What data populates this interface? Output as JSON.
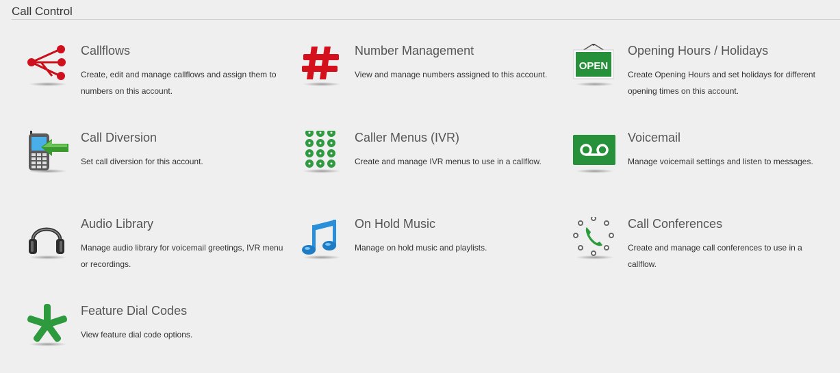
{
  "section": {
    "title": "Call Control"
  },
  "tiles": [
    {
      "title": "Callflows",
      "description": "Create, edit and manage callflows and assign them to numbers on this account.",
      "icon": "callflows-icon"
    },
    {
      "title": "Number Management",
      "description": "View and manage numbers assigned to this account.",
      "icon": "hash-icon"
    },
    {
      "title": "Opening Hours / Holidays",
      "description": "Create Opening Hours and set holidays for different opening times on this account.",
      "icon": "open-sign-icon",
      "icon_text": "OPEN"
    },
    {
      "title": "Call Diversion",
      "description": "Set call diversion for this account.",
      "icon": "phone-divert-icon"
    },
    {
      "title": "Caller Menus (IVR)",
      "description": "Create and manage IVR menus to use in a callflow.",
      "icon": "keypad-icon"
    },
    {
      "title": "Voicemail",
      "description": "Manage voicemail settings and listen to messages.",
      "icon": "voicemail-icon"
    },
    {
      "title": "Audio Library",
      "description": "Manage audio library for voicemail greetings, IVR menu or recordings.",
      "icon": "headphones-icon"
    },
    {
      "title": "On Hold Music",
      "description": "Manage on hold music and playlists.",
      "icon": "music-note-icon"
    },
    {
      "title": "Call Conferences",
      "description": "Create and manage call conferences to use in a callflow.",
      "icon": "conference-icon"
    },
    {
      "title": "Feature Dial Codes",
      "description": "View feature dial code options.",
      "icon": "asterisk-icon"
    }
  ],
  "colors": {
    "red": "#d0101c",
    "green": "#2e9a3e",
    "blue": "#2a8fd8"
  }
}
